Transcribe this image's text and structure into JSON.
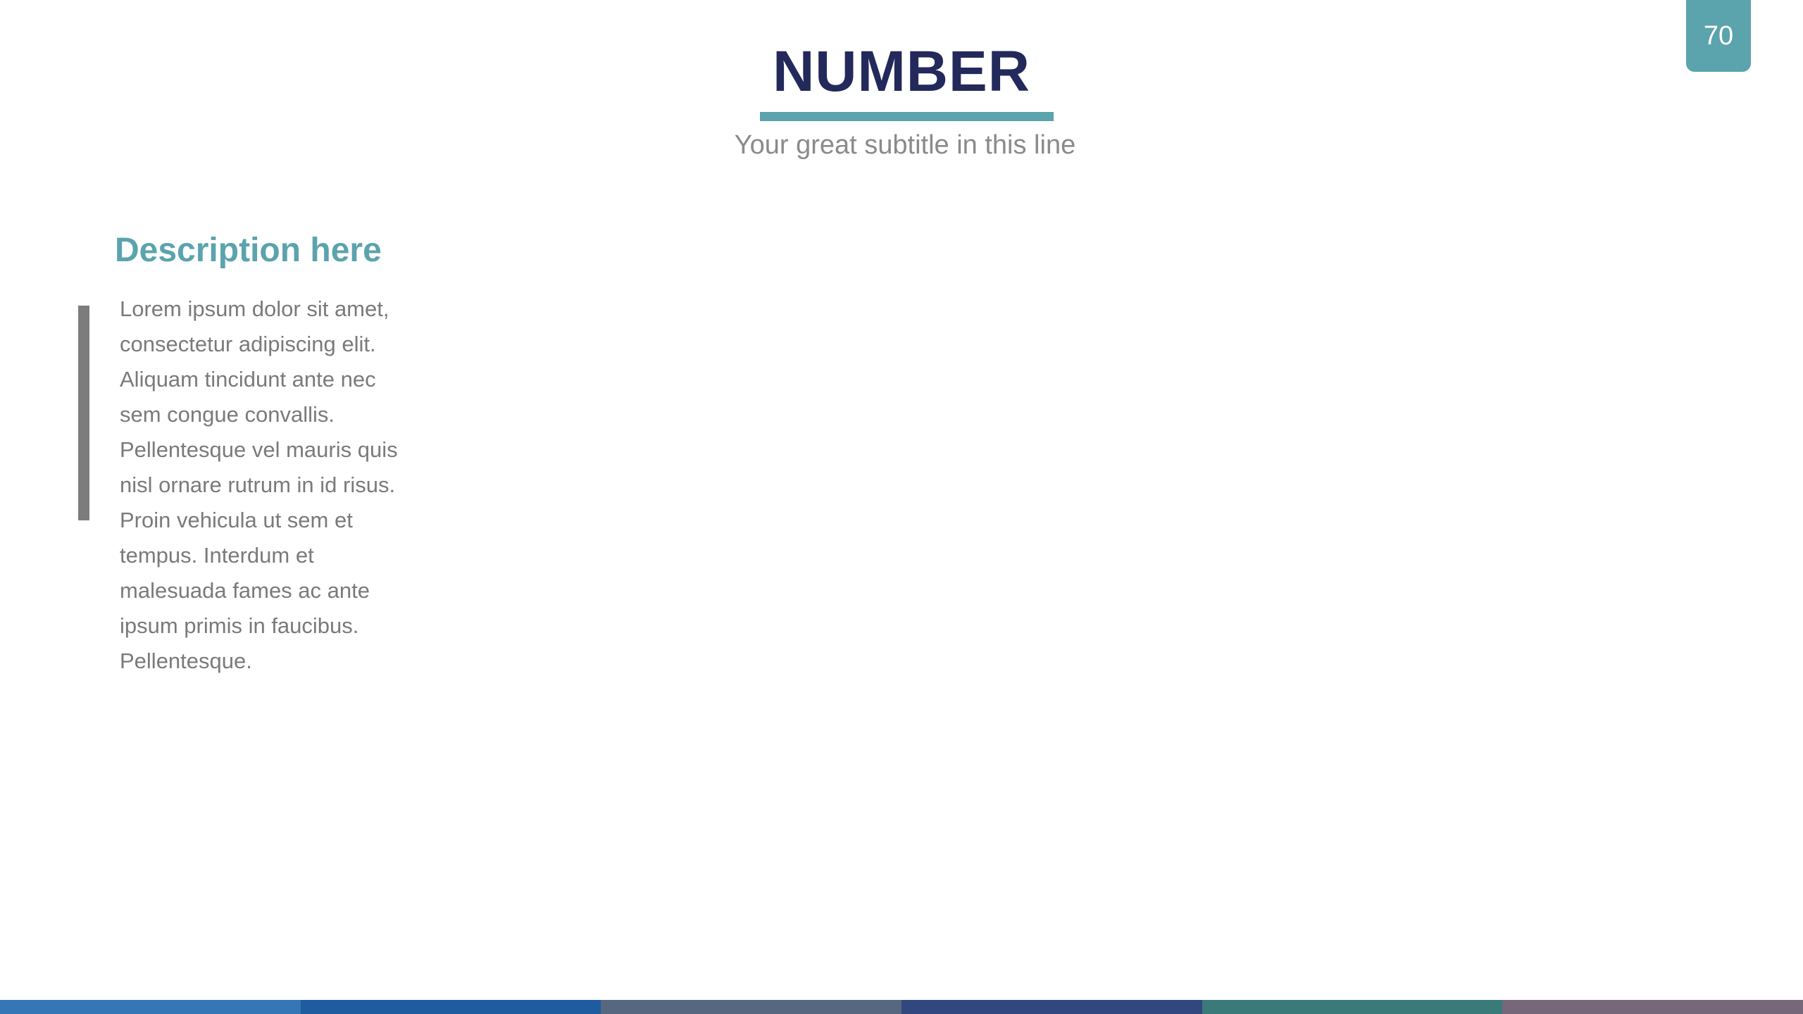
{
  "slide": {
    "page_number": "70",
    "title": "NUMBER",
    "subtitle": "Your great subtitle in this line",
    "description_heading": "Description here",
    "description_body": "Lorem ipsum dolor sit amet, consectetur adipiscing elit. Aliquam tincidunt ante nec sem congue convallis. Pellentesque vel mauris quis nisl ornare rutrum in id risus. Proin vehicula ut sem et tempus. Interdum et malesuada fames ac ante ipsum primis in faucibus. Pellentesque."
  },
  "colors": {
    "accent_teal": "#5ba3ad",
    "title_navy": "#23295a",
    "subtitle_gray": "#8a8a8a",
    "body_gray": "#7a7a7a",
    "quote_bar_gray": "#7c7c7c",
    "footer_segments": [
      "#3476b6",
      "#1f5c9f",
      "#56677f",
      "#32477d",
      "#3a7a79",
      "#77677a"
    ]
  }
}
